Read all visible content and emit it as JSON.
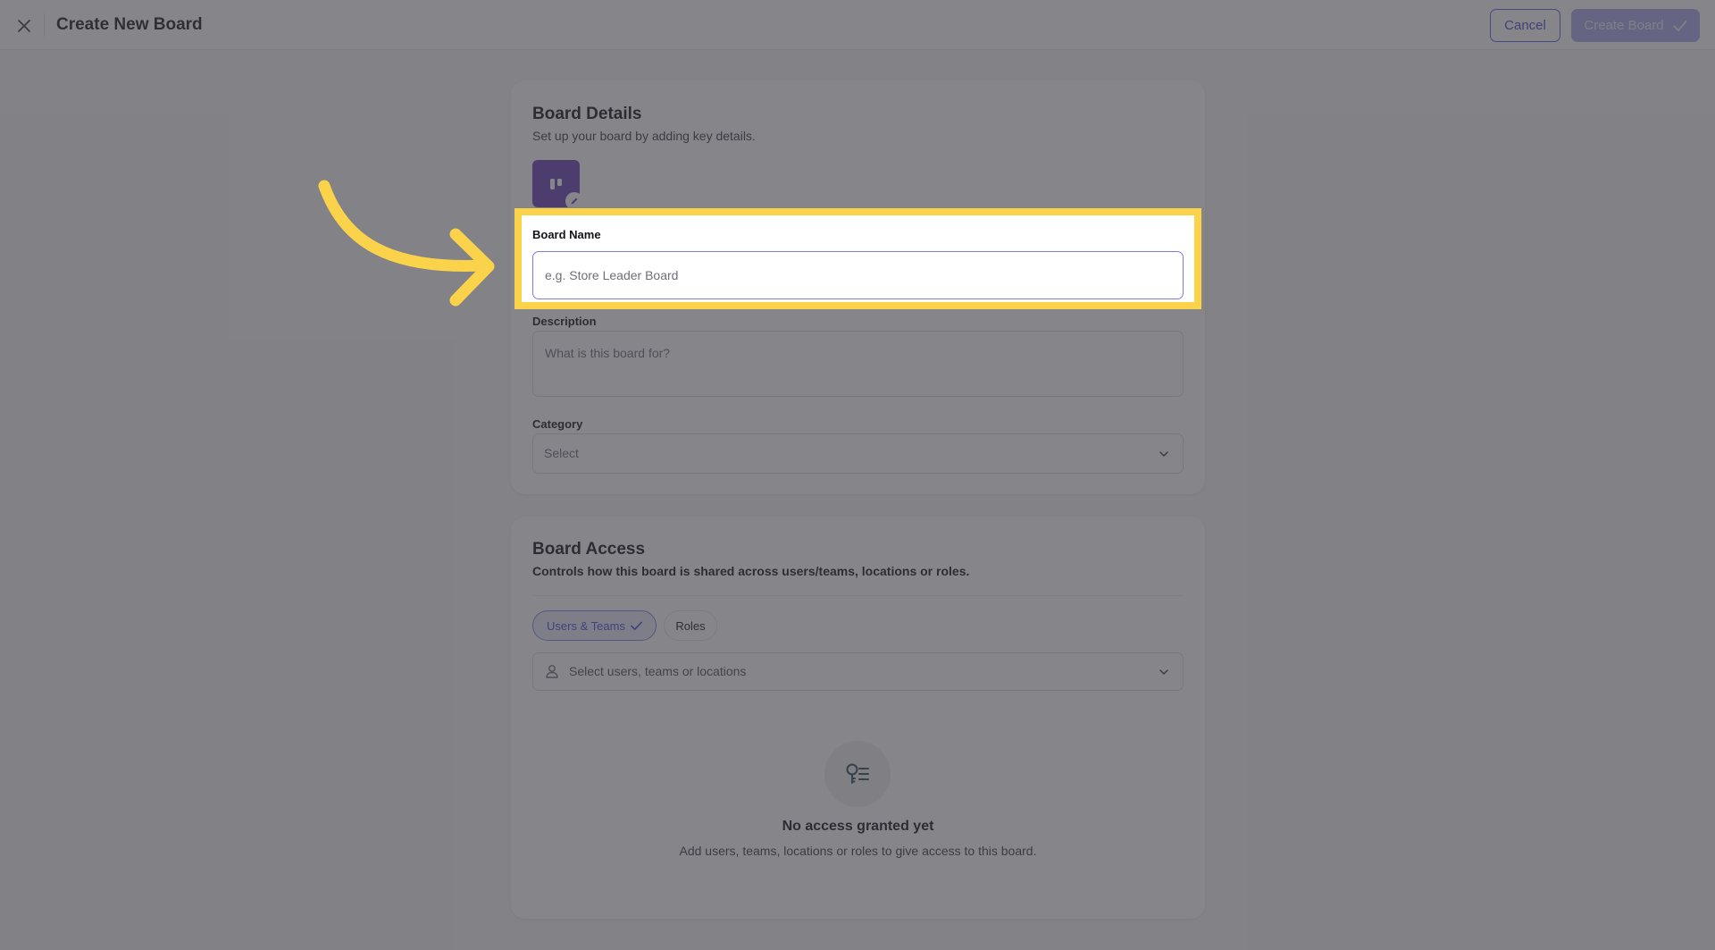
{
  "header": {
    "title": "Create New Board",
    "cancel_label": "Cancel",
    "create_label": "Create Board"
  },
  "board_details": {
    "title": "Board Details",
    "subtitle": "Set up your board by adding key details.",
    "name_label": "Board Name",
    "name_value": "",
    "name_placeholder": "e.g. Store Leader Board",
    "description_label": "Description",
    "description_placeholder": "What is this board for?",
    "category_label": "Category",
    "category_value": "Select"
  },
  "board_access": {
    "title": "Board Access",
    "subtitle": "Controls how this board is shared across users/teams, locations or roles.",
    "tabs": [
      {
        "label": "Users & Teams",
        "selected": true
      },
      {
        "label": "Roles",
        "selected": false
      }
    ],
    "select_placeholder": "Select users, teams or locations",
    "empty_title": "No access granted yet",
    "empty_subtitle": "Add users, teams, locations or roles to give access to this board."
  },
  "colors": {
    "accent": "#5b5ce6",
    "board_icon": "#6b3fb8",
    "highlight": "#fbd34a"
  },
  "icons": [
    "close-icon",
    "check-icon",
    "board-icon",
    "pencil-icon",
    "chevron-down-icon",
    "user-icon",
    "key-list-icon",
    "arrow-annotation"
  ]
}
